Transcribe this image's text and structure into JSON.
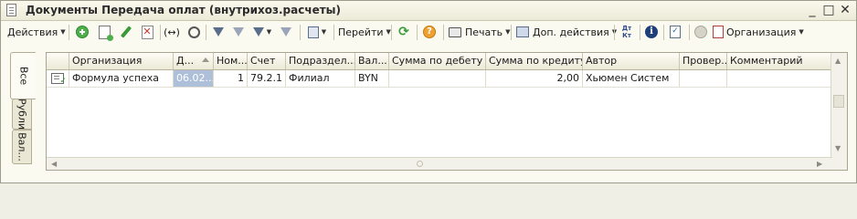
{
  "window": {
    "title": "Документы Передача оплат (внутрихоз.расчеты)",
    "controls": [
      "_",
      "□",
      "✕"
    ]
  },
  "toolbar": {
    "actions_label": "Действия",
    "goto_label": "Перейти",
    "print_label": "Печать",
    "extra_actions_label": "Доп. действия",
    "dt_kt_label": "Дт Кт",
    "org_label": "Организация"
  },
  "tabs": [
    "Все",
    "Рубли",
    "Вал..."
  ],
  "table": {
    "columns": [
      "",
      "Организация",
      "Д...",
      "Ном...",
      "Счет",
      "Подраздел...",
      "Вал...",
      "Сумма по дебету",
      "Сумма по кредиту",
      "Автор",
      "Провер...",
      "Комментарий"
    ],
    "rows": [
      {
        "icon": "document-posted-icon",
        "org": "Формула успеха",
        "date": "06.02...",
        "number": "1",
        "account": "79.2.1",
        "division": "Филиал",
        "currency": "BYN",
        "debit": "",
        "credit": "2,00",
        "author": "Хьюмен Систем",
        "checked": "",
        "comment": ""
      }
    ]
  },
  "colors": {
    "accent_green": "#3a9a3a",
    "selection": "#aebfd9"
  }
}
